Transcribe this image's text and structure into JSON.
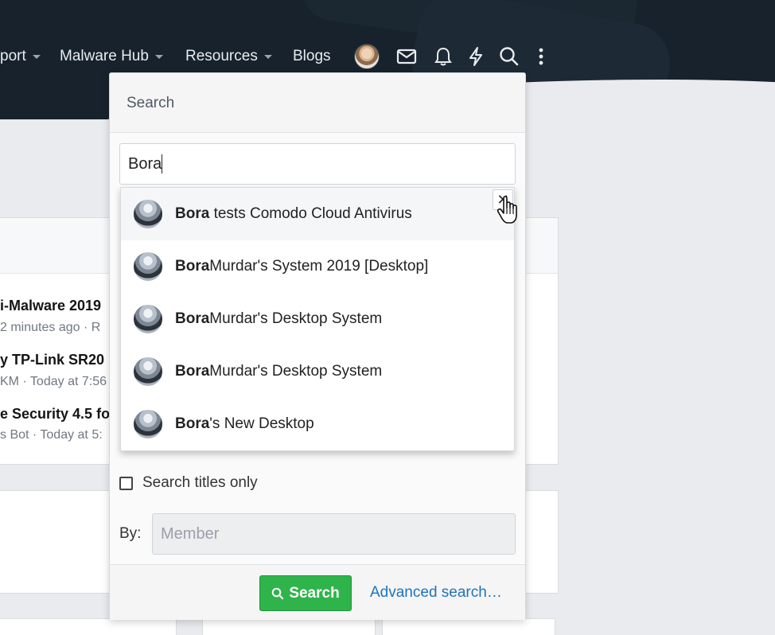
{
  "nav": {
    "items": [
      {
        "label": "port",
        "has_caret": true
      },
      {
        "label": "Malware Hub",
        "has_caret": true
      },
      {
        "label": "Resources",
        "has_caret": true
      },
      {
        "label": "Blogs",
        "has_caret": false
      }
    ],
    "icons": [
      "avatar",
      "mail-icon",
      "bell-icon",
      "bolt-icon",
      "search-icon",
      "more-vertical-icon"
    ]
  },
  "background": {
    "threads": [
      {
        "title": "i-Malware 2019",
        "meta": "2 minutes ago · R"
      },
      {
        "title": "y TP-Link SR20 I",
        "meta": "KM · Today at 7:56"
      },
      {
        "title": "e Security 4.5 fo",
        "meta": "s Bot · Today at 5:"
      }
    ]
  },
  "search_popup": {
    "title": "Search",
    "query": "Bora",
    "suggestions": [
      {
        "bold": "Bora",
        "rest": " tests Comodo Cloud Antivirus"
      },
      {
        "bold": "Bora",
        "rest": "Murdar's System 2019 [Desktop]"
      },
      {
        "bold": "Bora",
        "rest": "Murdar's Desktop System"
      },
      {
        "bold": "Bora",
        "rest": "Murdar's Desktop System"
      },
      {
        "bold": "Bora",
        "rest": "'s New Desktop"
      }
    ],
    "close_symbol": "✕",
    "titles_only_label": "Search titles only",
    "by_label": "By:",
    "member_placeholder": "Member",
    "search_button": "Search",
    "advanced_link": "Advanced search…"
  },
  "colors": {
    "header_bg": "#17222c",
    "search_button": "#2fb44c",
    "link": "#1e73be"
  }
}
